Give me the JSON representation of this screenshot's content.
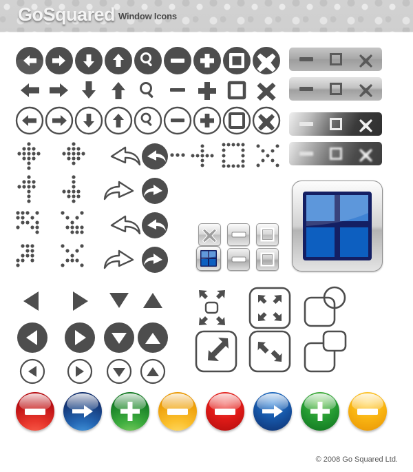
{
  "header": {
    "logo": "GoSquared",
    "title": "Window Icons",
    "bg_color": "#d0d0d0"
  },
  "footer": {
    "copyright": "© 2008 Go Squared Ltd."
  },
  "palette": {
    "icon_dark": "#4d4d4d",
    "icon_light": "#ffffff",
    "red": "#d81f26",
    "blue": "#1b4f9c",
    "green": "#2f9e34",
    "yellow": "#f6b417",
    "window_blue_light": "#3f83d4",
    "window_blue_dark": "#0d5fc0",
    "window_navy": "#141f63"
  },
  "rows": {
    "nav_filled": {
      "style": "filled-circle",
      "icons": [
        "arrow-left",
        "arrow-right",
        "arrow-down",
        "arrow-up",
        "search",
        "minus",
        "plus",
        "maximize",
        "close"
      ]
    },
    "nav_plain": {
      "style": "plain-glyph",
      "icons": [
        "arrow-left",
        "arrow-right",
        "arrow-down",
        "arrow-up",
        "search",
        "minus",
        "plus",
        "maximize",
        "close"
      ]
    },
    "nav_outline": {
      "style": "outline-circle",
      "icons": [
        "arrow-left",
        "arrow-right",
        "arrow-down",
        "arrow-up",
        "search",
        "minus",
        "plus",
        "maximize",
        "close"
      ]
    },
    "dotted": {
      "icons": [
        "dotted-move-cross",
        "dotted-move-cross-alt",
        "curved-arrow-left-outline",
        "curved-arrow-left-filled",
        "dotted-ellipsis",
        "dotted-cross",
        "dotted-square",
        "dotted-x"
      ]
    },
    "dotted_row2": {
      "icons": [
        "dotted-arrow-up",
        "dotted-arrow-down",
        "curved-arrow-right-outline",
        "curved-arrow-right-filled"
      ]
    },
    "dotted_row3": {
      "icons": [
        "dotted-diag-cross",
        "dotted-diag-cross-alt",
        "curved-arrow-left-outline",
        "curved-arrow-left-filled"
      ]
    },
    "dotted_row4": {
      "icons": [
        "dotted-diag-x",
        "dotted-diag-x-alt",
        "curved-arrow-right-outline",
        "curved-arrow-right-filled"
      ]
    },
    "triangles_plain": {
      "icons": [
        "triangle-left",
        "triangle-right",
        "triangle-down",
        "triangle-up"
      ]
    },
    "triangles_filled": {
      "icons": [
        "triangle-left",
        "triangle-right",
        "triangle-down",
        "triangle-up"
      ]
    },
    "triangles_outline": {
      "icons": [
        "triangle-left",
        "triangle-right",
        "triangle-down",
        "triangle-up"
      ]
    },
    "resize": {
      "row1": [
        "expand-four-arrows",
        "collapse-four-arrows-boxed",
        "windows-overlap-circle"
      ],
      "row2": [
        "expand-diagonal-boxed",
        "collapse-diagonal-boxed",
        "windows-overlap-rounded"
      ]
    }
  },
  "window_bars": [
    {
      "name": "window-bar-light",
      "buttons": [
        "minimize",
        "maximize",
        "close"
      ]
    },
    {
      "name": "window-bar-silver",
      "buttons": [
        "minimize",
        "maximize",
        "close"
      ]
    },
    {
      "name": "window-bar-dark",
      "buttons": [
        "minimize",
        "maximize",
        "close"
      ]
    },
    {
      "name": "window-bar-dark-glow",
      "buttons": [
        "minimize",
        "maximize",
        "close"
      ]
    }
  ],
  "glossy_buttons": {
    "row1": [
      "close",
      "minimize",
      "maximize"
    ],
    "row2": [
      "close",
      "minimize",
      "maximize"
    ]
  },
  "window_tiles": {
    "small": "four-pane-window",
    "large": "four-pane-window"
  },
  "orbs": [
    {
      "name": "orb-red-minus",
      "color": "#d81f26",
      "glyph": "minus",
      "style": "deep-gloss"
    },
    {
      "name": "orb-blue-arrow",
      "color": "#1b4f9c",
      "glyph": "arrow-right",
      "style": "deep-gloss"
    },
    {
      "name": "orb-green-plus",
      "color": "#2f9e34",
      "glyph": "plus",
      "style": "deep-gloss"
    },
    {
      "name": "orb-yellow-minus",
      "color": "#f6b417",
      "glyph": "minus",
      "style": "deep-gloss"
    },
    {
      "name": "orb-red-minus-2",
      "color": "#e01b18",
      "glyph": "minus",
      "style": "top-gloss"
    },
    {
      "name": "orb-blue-arrow-2",
      "color": "#1757a8",
      "glyph": "arrow-right",
      "style": "top-gloss"
    },
    {
      "name": "orb-green-plus-2",
      "color": "#259b32",
      "glyph": "plus",
      "style": "top-gloss"
    },
    {
      "name": "orb-yellow-minus-2",
      "color": "#f9b512",
      "glyph": "minus",
      "style": "top-gloss"
    }
  ]
}
